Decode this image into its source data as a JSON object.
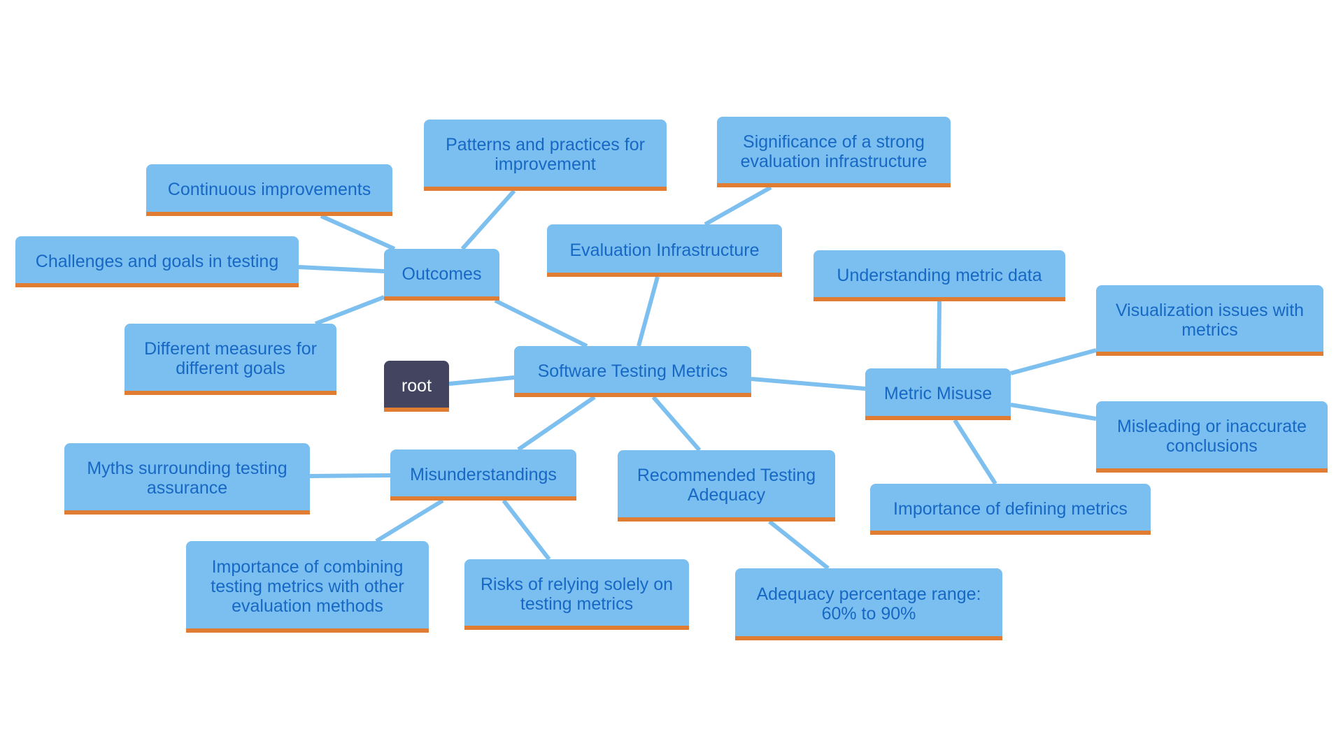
{
  "diagram": {
    "type": "mindmap",
    "colors": {
      "node_fill": "#7bbff0",
      "node_border": "#e07d33",
      "node_text": "#1768c4",
      "root_fill": "#434560",
      "root_text": "#ffffff",
      "edge": "#7dbfee"
    },
    "nodes": {
      "root": {
        "label": "root"
      },
      "stm": {
        "label": "Software Testing Metrics"
      },
      "outcomes": {
        "label": "Outcomes"
      },
      "continuous": {
        "label": "Continuous improvements"
      },
      "patterns": {
        "label": "Patterns and practices for improvement"
      },
      "challenges": {
        "label": "Challenges and goals in testing"
      },
      "different": {
        "label": "Different measures for different goals"
      },
      "evalinfra": {
        "label": "Evaluation Infrastructure"
      },
      "significance": {
        "label": "Significance of a strong evaluation infrastructure"
      },
      "misuse": {
        "label": "Metric Misuse"
      },
      "understanding": {
        "label": "Understanding metric data"
      },
      "visualization": {
        "label": "Visualization issues with metrics"
      },
      "misleading": {
        "label": "Misleading or inaccurate conclusions"
      },
      "defining": {
        "label": "Importance of defining metrics"
      },
      "misunderstandings": {
        "label": "Misunderstandings"
      },
      "myths": {
        "label": "Myths surrounding testing assurance"
      },
      "combining": {
        "label": "Importance of combining testing metrics with other evaluation methods"
      },
      "risks": {
        "label": "Risks of relying solely on testing metrics"
      },
      "recommended": {
        "label": "Recommended Testing Adequacy"
      },
      "adequacy": {
        "label": "Adequacy percentage range: 60% to 90%"
      }
    },
    "edges": [
      [
        "root",
        "stm"
      ],
      [
        "stm",
        "outcomes"
      ],
      [
        "stm",
        "evalinfra"
      ],
      [
        "stm",
        "misuse"
      ],
      [
        "stm",
        "misunderstandings"
      ],
      [
        "stm",
        "recommended"
      ],
      [
        "outcomes",
        "continuous"
      ],
      [
        "outcomes",
        "patterns"
      ],
      [
        "outcomes",
        "challenges"
      ],
      [
        "outcomes",
        "different"
      ],
      [
        "evalinfra",
        "significance"
      ],
      [
        "misuse",
        "understanding"
      ],
      [
        "misuse",
        "visualization"
      ],
      [
        "misuse",
        "misleading"
      ],
      [
        "misuse",
        "defining"
      ],
      [
        "misunderstandings",
        "myths"
      ],
      [
        "misunderstandings",
        "combining"
      ],
      [
        "misunderstandings",
        "risks"
      ],
      [
        "recommended",
        "adequacy"
      ]
    ]
  }
}
